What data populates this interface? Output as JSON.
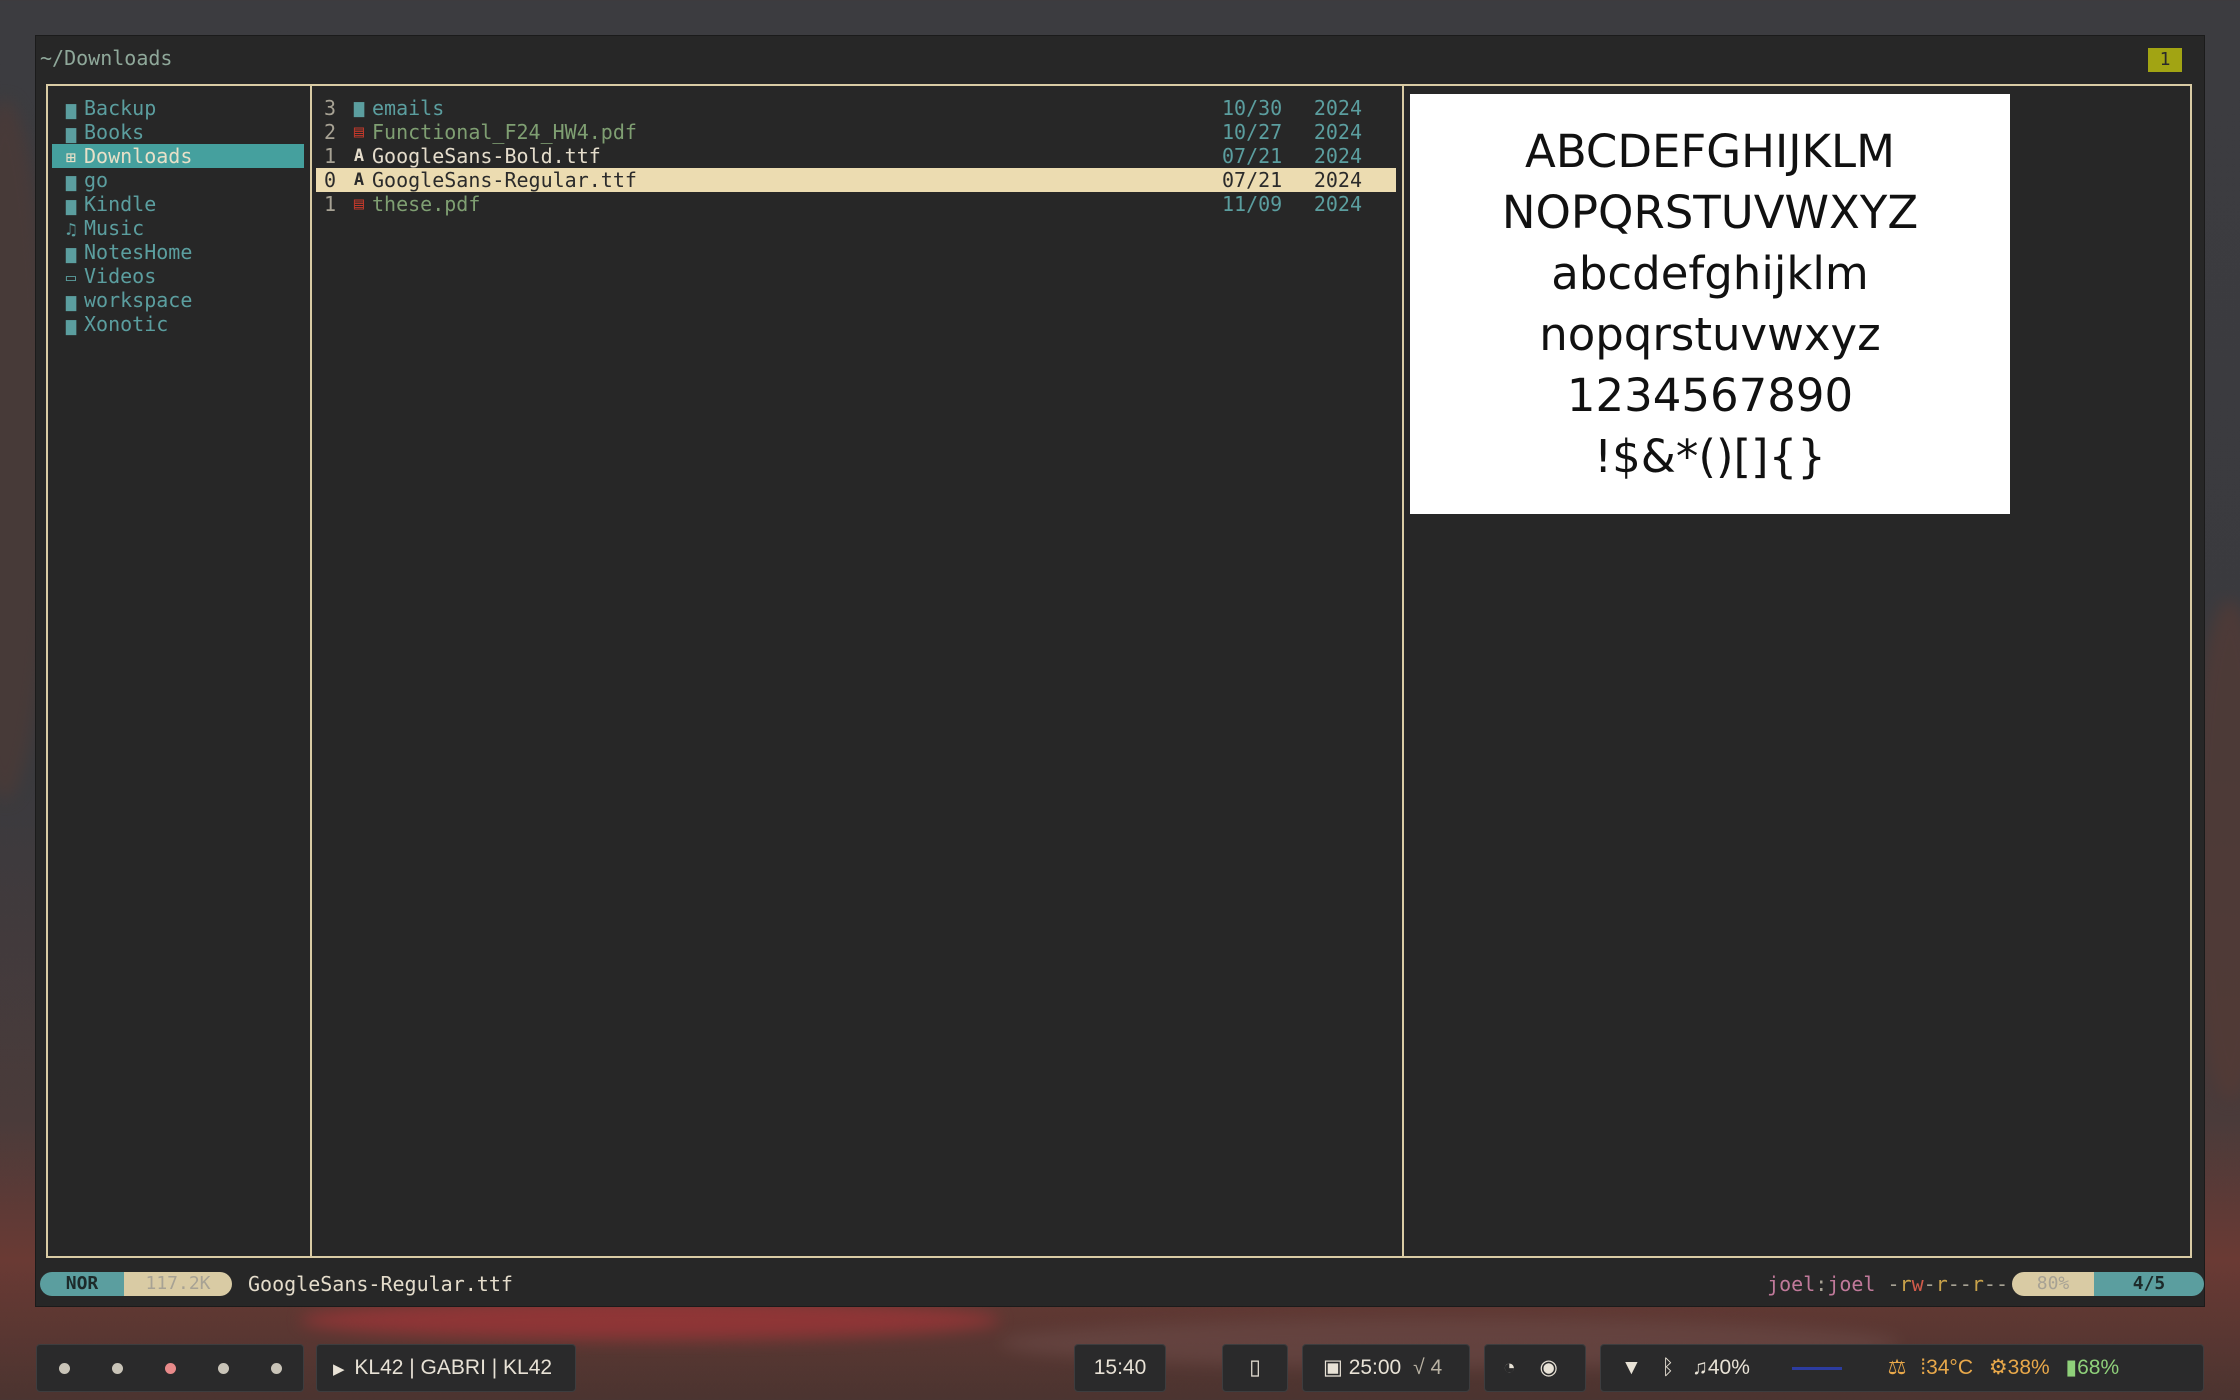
{
  "window": {
    "path": "~/Downloads",
    "tab": "1"
  },
  "parent_dirs": [
    {
      "icon": "folder-icon",
      "glyph": "▆",
      "label": "Backup",
      "active": false
    },
    {
      "icon": "folder-icon",
      "glyph": "▆",
      "label": "Books",
      "active": false
    },
    {
      "icon": "download-folder-icon",
      "glyph": "⊞",
      "label": "Downloads",
      "active": true
    },
    {
      "icon": "folder-icon",
      "glyph": "▆",
      "label": "go",
      "active": false
    },
    {
      "icon": "folder-icon",
      "glyph": "▆",
      "label": "Kindle",
      "active": false
    },
    {
      "icon": "headphones-icon",
      "glyph": "♫",
      "label": "Music",
      "active": false
    },
    {
      "icon": "folder-icon",
      "glyph": "▆",
      "label": "NotesHome",
      "active": false
    },
    {
      "icon": "video-icon",
      "glyph": "▭",
      "label": "Videos",
      "active": false
    },
    {
      "icon": "folder-icon",
      "glyph": "▆",
      "label": "workspace",
      "active": false
    },
    {
      "icon": "folder-icon",
      "glyph": "▆",
      "label": "Xonotic",
      "active": false
    }
  ],
  "files": [
    {
      "num": "3",
      "icon": "folder-icon",
      "glyph": "▆",
      "name": "emails",
      "date": "10/30",
      "year": "2024",
      "style": "dir"
    },
    {
      "num": "2",
      "icon": "pdf-icon",
      "glyph": "▤",
      "name": "Functional_F24_HW4.pdf",
      "date": "10/27",
      "year": "2024",
      "style": "pdf"
    },
    {
      "num": "1",
      "icon": "font-icon",
      "glyph": "A",
      "name": "GoogleSans-Bold.ttf",
      "date": "07/21",
      "year": "2024",
      "style": "font"
    },
    {
      "num": "0",
      "icon": "font-icon",
      "glyph": "A",
      "name": "GoogleSans-Regular.ttf",
      "date": "07/21",
      "year": "2024",
      "style": "cursor"
    },
    {
      "num": "1",
      "icon": "pdf-icon",
      "glyph": "▤",
      "name": "these.pdf",
      "date": "11/09",
      "year": "2024",
      "style": "pdf"
    }
  ],
  "preview_lines": [
    "ABCDEFGHIJKLM",
    "NOPQRSTUVWXYZ",
    "abcdefghijklm",
    "nopqrstuvwxyz",
    "1234567890",
    "!$&*()[]{}"
  ],
  "status": {
    "mode": "NOR",
    "size": "117.2K",
    "filename": "GoogleSans-Regular.ttf",
    "owner_user": "joel",
    "owner_sep": ":",
    "owner_group": "joel",
    "perm_dash1": "-",
    "perm_r1": "r",
    "perm_w1": "w",
    "perm_dash2": "-",
    "perm_r2": "r",
    "perm_dash3": "--",
    "perm_r3": "r",
    "perm_dash4": "--",
    "percent": "80%",
    "position": "4/5"
  },
  "taskbar": {
    "media": "KL42 | GABRI | KL42",
    "clock": "15:40",
    "timer": "25:00",
    "timer_check": "√ 4",
    "volume": "40%",
    "temperature": "34°C",
    "cpu": "38%",
    "battery": "68%"
  },
  "colors": {
    "accent_teal": "#5b9e9f",
    "accent_sand": "#d9cba4",
    "tab_yellow": "#a2a413",
    "file_green": "#7f9f72",
    "status_orange": "#e8a84a",
    "status_green": "#8fd07a",
    "urgent_red": "#e88a8a"
  }
}
